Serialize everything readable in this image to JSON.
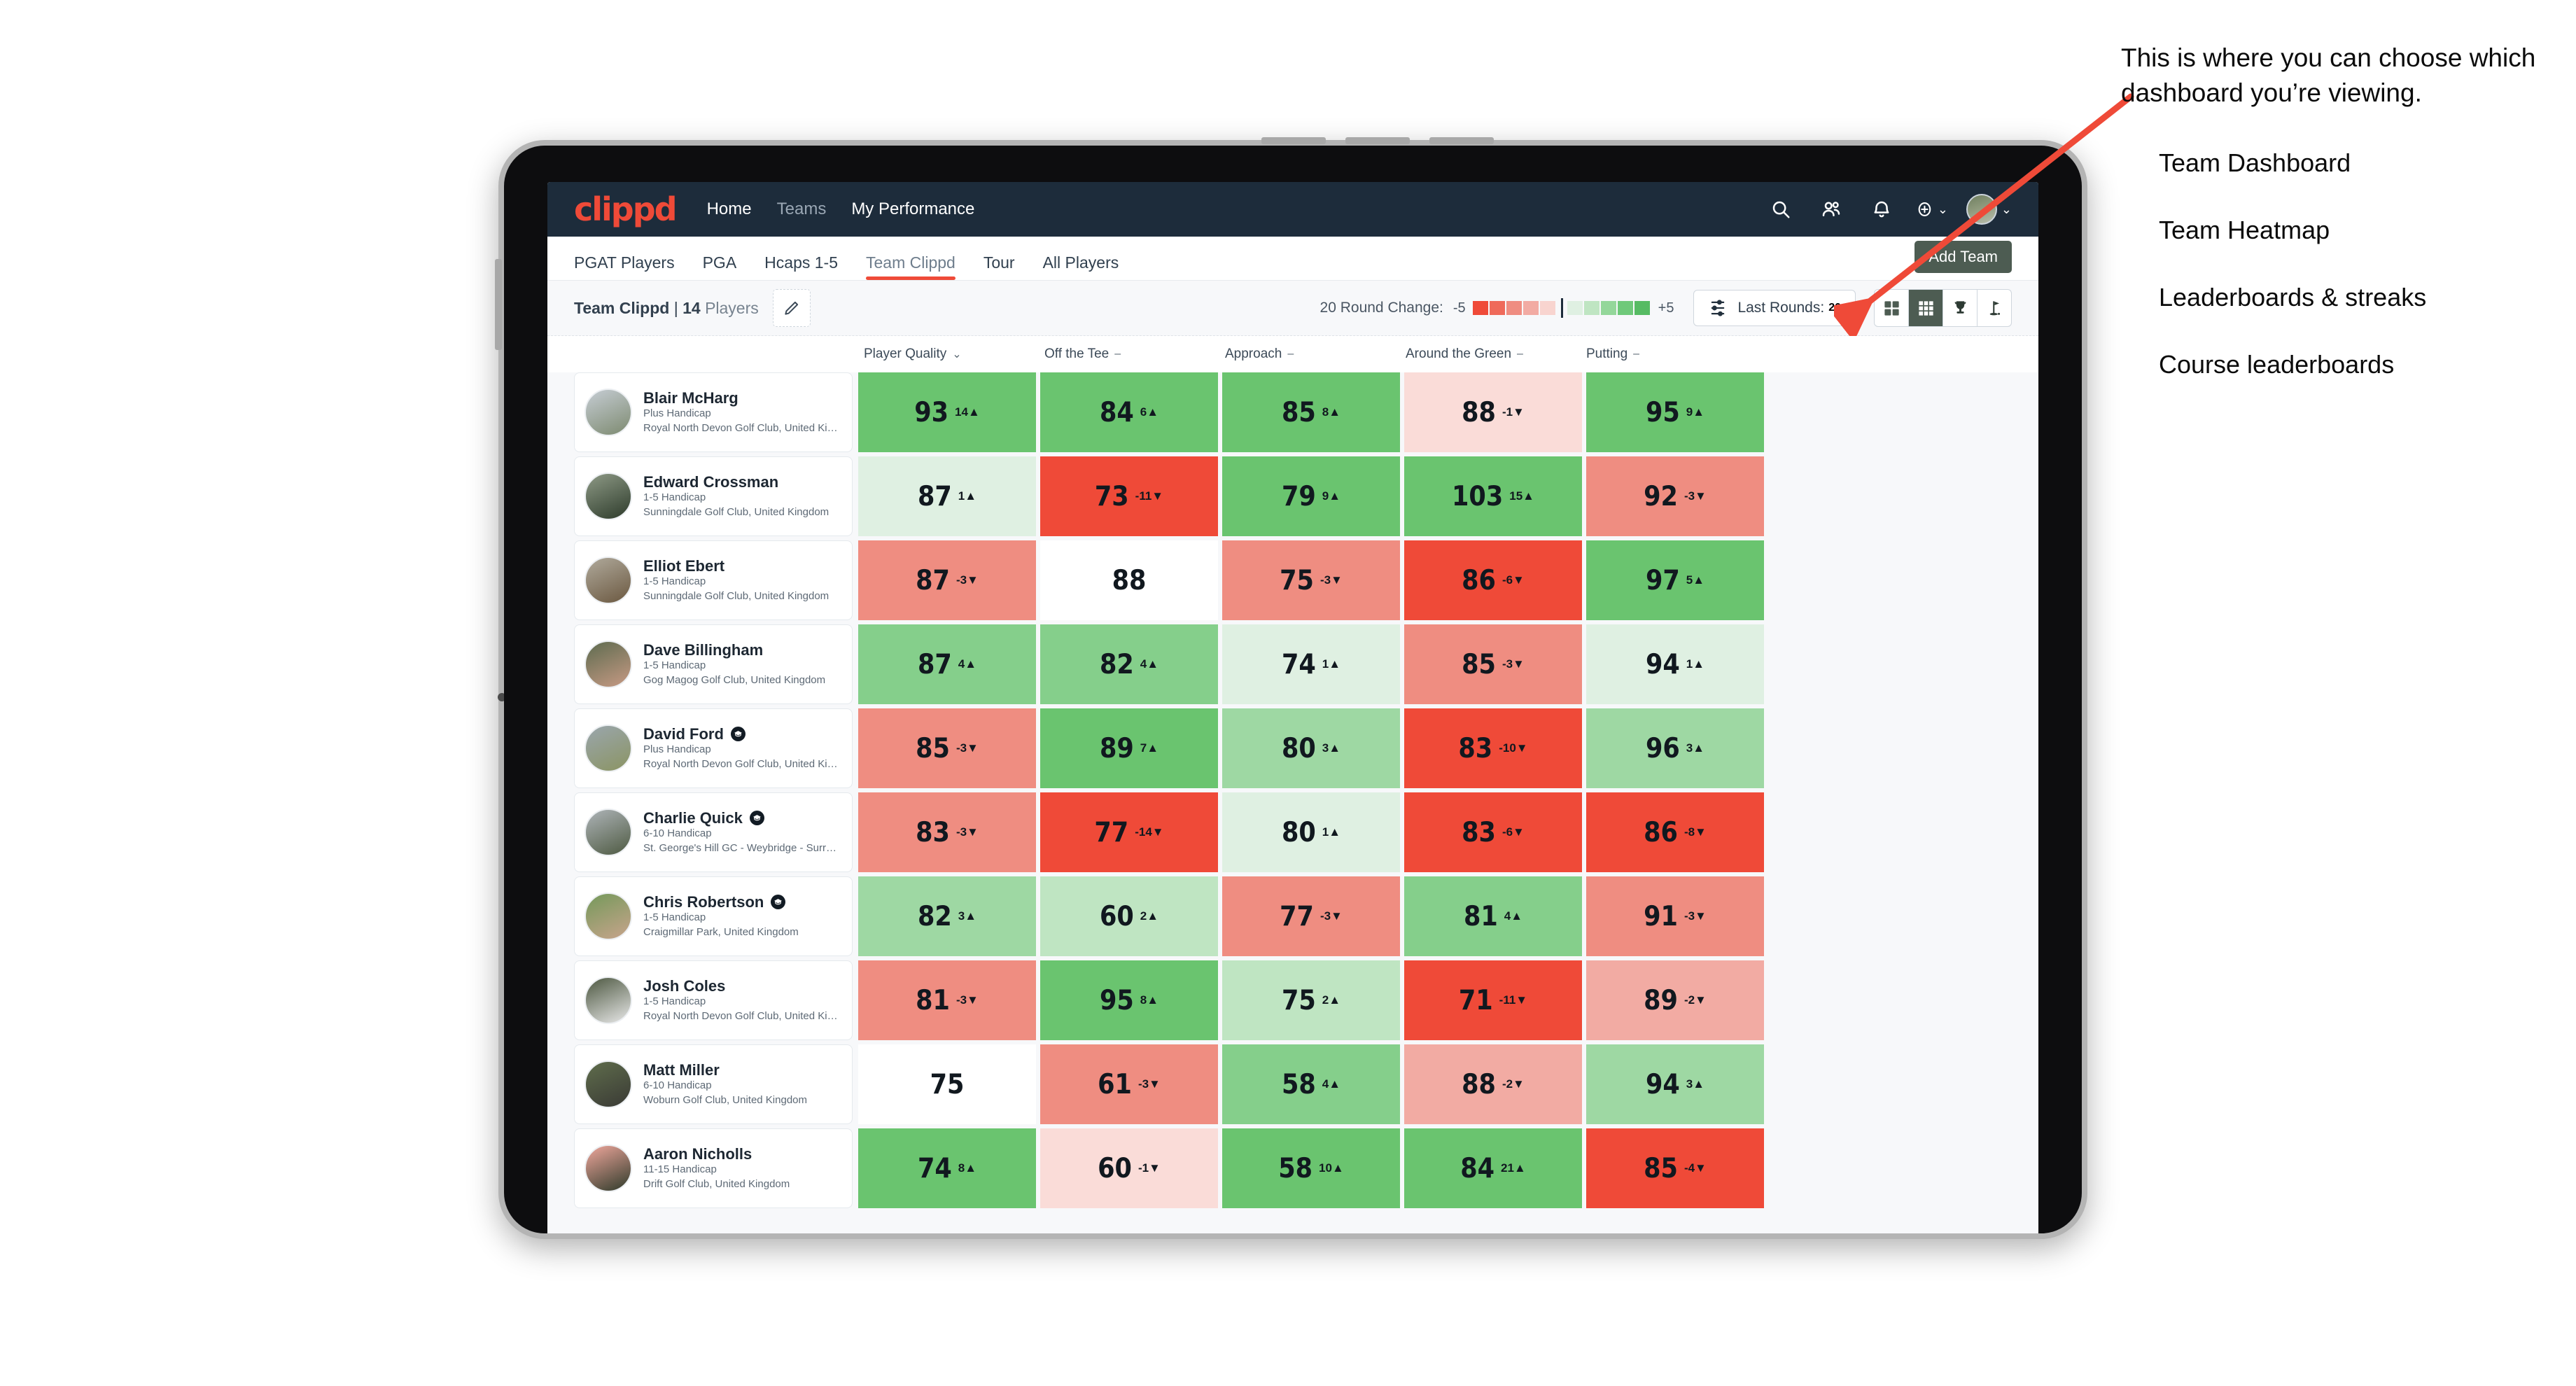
{
  "header": {
    "brand": "clippd",
    "nav": [
      {
        "label": "Home",
        "dim": false
      },
      {
        "label": "Teams",
        "dim": true
      },
      {
        "label": "My Performance",
        "dim": false
      }
    ],
    "icons": [
      "search-icon",
      "people-icon",
      "bell-icon",
      "plus-circle-icon"
    ],
    "avatar": "user-avatar"
  },
  "subtabs": {
    "items": [
      {
        "label": "PGAT Players",
        "active": false
      },
      {
        "label": "PGA",
        "active": false
      },
      {
        "label": "Hcaps 1-5",
        "active": false
      },
      {
        "label": "Team Clippd",
        "active": true
      },
      {
        "label": "Tour",
        "active": false
      },
      {
        "label": "All Players",
        "active": false
      }
    ],
    "add_team_label": "Add Team"
  },
  "toolbar": {
    "team_name": "Team Clippd",
    "separator": "|",
    "player_count": "14",
    "players_word": "Players",
    "edit_icon": "pencil-icon",
    "round_change_label": "20 Round Change:",
    "scale_min": "-5",
    "scale_max": "+5",
    "scale_colors": [
      "#ef4a38",
      "#ef6a5a",
      "#ef8d81",
      "#f2aba3",
      "#f8d4cf",
      "#ffffff",
      "#dcefdc",
      "#bfe5c0",
      "#94d79a",
      "#6fc97a",
      "#56bb63"
    ],
    "last_rounds_label": "Last Rounds:",
    "last_rounds_value": "20",
    "views": [
      {
        "icon": "grid-four-icon",
        "active": false
      },
      {
        "icon": "heatmap-grid-icon",
        "active": true
      },
      {
        "icon": "trophy-icon",
        "active": false
      },
      {
        "icon": "golf-flag-icon",
        "active": false
      }
    ]
  },
  "columns": [
    {
      "label": "Player Quality",
      "glyph": "chevron-down"
    },
    {
      "label": "Off the Tee",
      "glyph": "dash"
    },
    {
      "label": "Approach",
      "glyph": "dash"
    },
    {
      "label": "Around the Green",
      "glyph": "dash"
    },
    {
      "label": "Putting",
      "glyph": "dash"
    }
  ],
  "chart_data": {
    "type": "heatmap",
    "title": "Team Clippd | 14 Players",
    "categories": [
      "Player Quality",
      "Off the Tee",
      "Approach",
      "Around the Green",
      "Putting"
    ],
    "row_labels": [
      "Blair McHarg",
      "Edward Crossman",
      "Elliot Ebert",
      "Dave Billingham",
      "David Ford",
      "Charlie Quick",
      "Chris Robertson",
      "Josh Coles",
      "Matt Miller",
      "Aaron Nicholls"
    ],
    "legend": {
      "label": "20 Round Change:",
      "min": "-5",
      "max": "+5"
    },
    "values": [
      [
        93,
        84,
        85,
        88,
        95
      ],
      [
        87,
        73,
        79,
        103,
        92
      ],
      [
        87,
        88,
        75,
        86,
        97
      ],
      [
        87,
        82,
        74,
        85,
        94
      ],
      [
        85,
        89,
        80,
        83,
        96
      ],
      [
        83,
        77,
        80,
        83,
        86
      ],
      [
        82,
        60,
        77,
        81,
        91
      ],
      [
        81,
        95,
        75,
        71,
        89
      ],
      [
        75,
        61,
        58,
        88,
        94
      ],
      [
        74,
        60,
        58,
        84,
        85
      ]
    ],
    "deltas": [
      [
        14,
        6,
        8,
        -1,
        9
      ],
      [
        1,
        -11,
        9,
        15,
        -3
      ],
      [
        -3,
        null,
        -3,
        -6,
        5
      ],
      [
        4,
        4,
        1,
        -3,
        1
      ],
      [
        -3,
        7,
        3,
        -10,
        3
      ],
      [
        -3,
        -14,
        1,
        -6,
        -8
      ],
      [
        3,
        2,
        -3,
        4,
        -3
      ],
      [
        -3,
        8,
        2,
        -11,
        -2
      ],
      [
        null,
        -3,
        4,
        -2,
        3
      ],
      [
        8,
        -1,
        10,
        21,
        -4
      ]
    ]
  },
  "players": [
    {
      "name": "Blair McHarg",
      "graduate": false,
      "handicap": "Plus Handicap",
      "club": "Royal North Devon Golf Club, United Kingdom",
      "avatar_colors": [
        "#c6cdd4",
        "#7d8a70"
      ],
      "cells": [
        {
          "value": "93",
          "delta": "14",
          "dir": "up",
          "bg": "#6ac46f"
        },
        {
          "value": "84",
          "delta": "6",
          "dir": "up",
          "bg": "#6ac46f"
        },
        {
          "value": "85",
          "delta": "8",
          "dir": "up",
          "bg": "#6ac46f"
        },
        {
          "value": "88",
          "delta": "-1",
          "dir": "down",
          "bg": "#fadcd8"
        },
        {
          "value": "95",
          "delta": "9",
          "dir": "up",
          "bg": "#6ac46f"
        }
      ]
    },
    {
      "name": "Edward Crossman",
      "graduate": false,
      "handicap": "1-5 Handicap",
      "club": "Sunningdale Golf Club, United Kingdom",
      "avatar_colors": [
        "#8e9a86",
        "#2d3b2b"
      ],
      "cells": [
        {
          "value": "87",
          "delta": "1",
          "dir": "up",
          "bg": "#dff0e2"
        },
        {
          "value": "73",
          "delta": "-11",
          "dir": "down",
          "bg": "#ef4a38"
        },
        {
          "value": "79",
          "delta": "9",
          "dir": "up",
          "bg": "#6ac46f"
        },
        {
          "value": "103",
          "delta": "15",
          "dir": "up",
          "bg": "#6ac46f"
        },
        {
          "value": "92",
          "delta": "-3",
          "dir": "down",
          "bg": "#ef8d81"
        }
      ]
    },
    {
      "name": "Elliot Ebert",
      "graduate": false,
      "handicap": "1-5 Handicap",
      "club": "Sunningdale Golf Club, United Kingdom",
      "avatar_colors": [
        "#b0aa9c",
        "#6b5840"
      ],
      "cells": [
        {
          "value": "87",
          "delta": "-3",
          "dir": "down",
          "bg": "#ef8d81"
        },
        {
          "value": "88",
          "delta": "",
          "dir": "",
          "bg": "#ffffff"
        },
        {
          "value": "75",
          "delta": "-3",
          "dir": "down",
          "bg": "#ef8d81"
        },
        {
          "value": "86",
          "delta": "-6",
          "dir": "down",
          "bg": "#ef4a38"
        },
        {
          "value": "97",
          "delta": "5",
          "dir": "up",
          "bg": "#6ac46f"
        }
      ]
    },
    {
      "name": "Dave Billingham",
      "graduate": false,
      "handicap": "1-5 Handicap",
      "club": "Gog Magog Golf Club, United Kingdom",
      "avatar_colors": [
        "#5d6b4f",
        "#c79a84"
      ],
      "cells": [
        {
          "value": "87",
          "delta": "4",
          "dir": "up",
          "bg": "#85cf8b"
        },
        {
          "value": "82",
          "delta": "4",
          "dir": "up",
          "bg": "#85cf8b"
        },
        {
          "value": "74",
          "delta": "1",
          "dir": "up",
          "bg": "#dff0e2"
        },
        {
          "value": "85",
          "delta": "-3",
          "dir": "down",
          "bg": "#ef8d81"
        },
        {
          "value": "94",
          "delta": "1",
          "dir": "up",
          "bg": "#dff0e2"
        }
      ]
    },
    {
      "name": "David Ford",
      "graduate": true,
      "handicap": "Plus Handicap",
      "club": "Royal North Devon Golf Club, United Kingdom",
      "avatar_colors": [
        "#9aa6ad",
        "#8b9463"
      ],
      "cells": [
        {
          "value": "85",
          "delta": "-3",
          "dir": "down",
          "bg": "#ef8d81"
        },
        {
          "value": "89",
          "delta": "7",
          "dir": "up",
          "bg": "#6ac46f"
        },
        {
          "value": "80",
          "delta": "3",
          "dir": "up",
          "bg": "#9ed8a3"
        },
        {
          "value": "83",
          "delta": "-10",
          "dir": "down",
          "bg": "#ef4a38"
        },
        {
          "value": "96",
          "delta": "3",
          "dir": "up",
          "bg": "#9ed8a3"
        }
      ]
    },
    {
      "name": "Charlie Quick",
      "graduate": true,
      "handicap": "6-10 Handicap",
      "club": "St. George's Hill GC - Weybridge - Surrey, Uni...",
      "avatar_colors": [
        "#aeb4b8",
        "#4e5a42"
      ],
      "cells": [
        {
          "value": "83",
          "delta": "-3",
          "dir": "down",
          "bg": "#ef8d81"
        },
        {
          "value": "77",
          "delta": "-14",
          "dir": "down",
          "bg": "#ef4a38"
        },
        {
          "value": "80",
          "delta": "1",
          "dir": "up",
          "bg": "#dff0e2"
        },
        {
          "value": "83",
          "delta": "-6",
          "dir": "down",
          "bg": "#ef4a38"
        },
        {
          "value": "86",
          "delta": "-8",
          "dir": "down",
          "bg": "#ef4a38"
        }
      ]
    },
    {
      "name": "Chris Robertson",
      "graduate": true,
      "handicap": "1-5 Handicap",
      "club": "Craigmillar Park, United Kingdom",
      "avatar_colors": [
        "#74995a",
        "#c8a48c"
      ],
      "cells": [
        {
          "value": "82",
          "delta": "3",
          "dir": "up",
          "bg": "#9ed8a3"
        },
        {
          "value": "60",
          "delta": "2",
          "dir": "up",
          "bg": "#bfe5c2"
        },
        {
          "value": "77",
          "delta": "-3",
          "dir": "down",
          "bg": "#ef8d81"
        },
        {
          "value": "81",
          "delta": "4",
          "dir": "up",
          "bg": "#85cf8b"
        },
        {
          "value": "91",
          "delta": "-3",
          "dir": "down",
          "bg": "#ef8d81"
        }
      ]
    },
    {
      "name": "Josh Coles",
      "graduate": false,
      "handicap": "1-5 Handicap",
      "club": "Royal North Devon Golf Club, United Kingdom",
      "avatar_colors": [
        "#4c5740",
        "#e8e8e8"
      ],
      "cells": [
        {
          "value": "81",
          "delta": "-3",
          "dir": "down",
          "bg": "#ef8d81"
        },
        {
          "value": "95",
          "delta": "8",
          "dir": "up",
          "bg": "#6ac46f"
        },
        {
          "value": "75",
          "delta": "2",
          "dir": "up",
          "bg": "#bfe5c2"
        },
        {
          "value": "71",
          "delta": "-11",
          "dir": "down",
          "bg": "#ef4a38"
        },
        {
          "value": "89",
          "delta": "-2",
          "dir": "down",
          "bg": "#f2aba3"
        }
      ]
    },
    {
      "name": "Matt Miller",
      "graduate": false,
      "handicap": "6-10 Handicap",
      "club": "Woburn Golf Club, United Kingdom",
      "avatar_colors": [
        "#5f6d4c",
        "#3a3a35"
      ],
      "cells": [
        {
          "value": "75",
          "delta": "",
          "dir": "",
          "bg": "#ffffff"
        },
        {
          "value": "61",
          "delta": "-3",
          "dir": "down",
          "bg": "#ef8d81"
        },
        {
          "value": "58",
          "delta": "4",
          "dir": "up",
          "bg": "#85cf8b"
        },
        {
          "value": "88",
          "delta": "-2",
          "dir": "down",
          "bg": "#f2aba3"
        },
        {
          "value": "94",
          "delta": "3",
          "dir": "up",
          "bg": "#9ed8a3"
        }
      ]
    },
    {
      "name": "Aaron Nicholls",
      "graduate": false,
      "handicap": "11-15 Handicap",
      "club": "Drift Golf Club, United Kingdom",
      "avatar_colors": [
        "#f0a79c",
        "#2e3a2a"
      ],
      "cells": [
        {
          "value": "74",
          "delta": "8",
          "dir": "up",
          "bg": "#6ac46f"
        },
        {
          "value": "60",
          "delta": "-1",
          "dir": "down",
          "bg": "#fadcd8"
        },
        {
          "value": "58",
          "delta": "10",
          "dir": "up",
          "bg": "#6ac46f"
        },
        {
          "value": "84",
          "delta": "21",
          "dir": "up",
          "bg": "#6ac46f"
        },
        {
          "value": "85",
          "delta": "-4",
          "dir": "down",
          "bg": "#ef4a38"
        }
      ]
    }
  ],
  "annotation": {
    "callout": "This is where you can choose which dashboard you’re viewing.",
    "items": [
      "Team Dashboard",
      "Team Heatmap",
      "Leaderboards & streaks",
      "Course leaderboards"
    ],
    "arrow_color": "#ef4a38"
  }
}
